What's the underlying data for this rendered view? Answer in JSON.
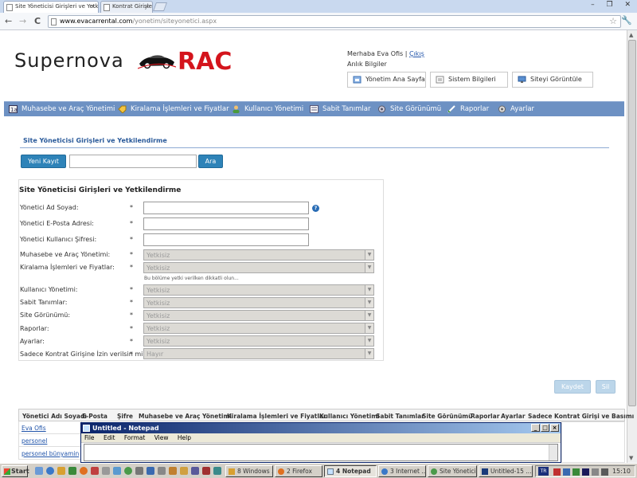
{
  "browser": {
    "tabs": [
      {
        "title": "Site Yöneticisi Girişleri ve Yetk",
        "close": "×"
      },
      {
        "title": "Kontrat Girişleri",
        "close": "×"
      }
    ],
    "window_controls": "– ❐ ✕",
    "url_host": "www.evacarrental.com",
    "url_path": "/yonetim/siteyonetici.aspx",
    "nav": {
      "back": "←",
      "forward": "→",
      "reload": "C"
    },
    "star": "☆",
    "wrench": "🔧"
  },
  "header": {
    "logo_text": "Supernova",
    "logo_rac": "RAC",
    "greeting": "Merhaba Eva Ofis |",
    "logout": "Çıkış",
    "anlik": "Anlık Bilgiler",
    "quick_links": [
      {
        "label": "Yönetim Ana Sayfa",
        "icon": "home-icon"
      },
      {
        "label": "Sistem Bilgileri",
        "icon": "info-icon"
      },
      {
        "label": "Siteyi Görüntüle",
        "icon": "monitor-icon"
      }
    ]
  },
  "menu": [
    {
      "label": "Muhasebe ve Araç Yönetimi",
      "icon": "ledger-icon"
    },
    {
      "label": "Kiralama İşlemleri ve Fiyatlar",
      "icon": "tag-icon"
    },
    {
      "label": "Kullanıcı Yönetimi",
      "icon": "user-icon"
    },
    {
      "label": "Sabit Tanımlar",
      "icon": "list-icon"
    },
    {
      "label": "Site Görünümü",
      "icon": "gear-icon"
    },
    {
      "label": "Raporlar",
      "icon": "report-icon"
    },
    {
      "label": "Ayarlar",
      "icon": "settings-icon"
    }
  ],
  "section_title": "Site Yöneticisi Girişleri ve Yetkilendirme",
  "search": {
    "new_button": "Yeni Kayıt",
    "search_button": "Ara",
    "value": ""
  },
  "form": {
    "title": "Site Yöneticisi Girişleri ve Yetkilendirme",
    "required_mark": "*",
    "fields": [
      {
        "label": "Yönetici Ad Soyad:",
        "type": "text",
        "value": ""
      },
      {
        "label": "Yönetici E-Posta Adresi:",
        "type": "text",
        "value": ""
      },
      {
        "label": "Yönetici Kullanıcı Şifresi:",
        "type": "text",
        "value": ""
      },
      {
        "label": "Muhasebe ve Araç Yönetimi:",
        "type": "select",
        "value": "Yetkisiz"
      },
      {
        "label": "Kiralama İşlemleri ve Fiyatlar:",
        "type": "select",
        "value": "Yetkisiz"
      },
      {
        "label": "Kullanıcı Yönetimi:",
        "type": "select",
        "value": "Yetkisiz"
      },
      {
        "label": "Sabit Tanımlar:",
        "type": "select",
        "value": "Yetkisiz"
      },
      {
        "label": "Site Görünümü:",
        "type": "select",
        "value": "Yetkisiz"
      },
      {
        "label": "Raporlar:",
        "type": "select",
        "value": "Yetkisiz"
      },
      {
        "label": "Ayarlar:",
        "type": "select",
        "value": "Yetkisiz"
      },
      {
        "label": "Sadece Kontrat Girişine İzin verilsin mi:",
        "type": "select",
        "value": "Hayır"
      }
    ],
    "help": "?",
    "note": "Bu bölüme yetki verilken dikkatli olun...",
    "save_button": "Kaydet",
    "delete_button": "Sil"
  },
  "table": {
    "headers": [
      "Yönetici Adı Soyadı",
      "E-Posta",
      "Şifre",
      "Muhasebe ve Araç Yönetimi",
      "Kiralama İşlemleri ve Fiyatlar",
      "Kullanıcı Yönetimi",
      "Sabit Tanımlar",
      "Site Görünümü",
      "Raporlar",
      "Ayarlar",
      "Sadece Kontrat Girişi ve Basımı"
    ],
    "rows": [
      "Eva Ofis",
      "personel",
      "personel bünyamin"
    ]
  },
  "notepad": {
    "title": "Untitled - Notepad",
    "menu": [
      "File",
      "Edit",
      "Format",
      "View",
      "Help"
    ],
    "buttons": [
      "_",
      "□",
      "×"
    ]
  },
  "taskbar": {
    "start": "Start",
    "tasks": [
      {
        "label": "8 Windows ...",
        "pressed": false
      },
      {
        "label": "2 Firefox",
        "pressed": false
      },
      {
        "label": "4 Notepad",
        "pressed": true
      },
      {
        "label": "3 Internet ...",
        "pressed": false
      },
      {
        "label": "Site Yönetici...",
        "pressed": false
      },
      {
        "label": "Untitled-15 ...",
        "pressed": false
      }
    ],
    "lang": "TR",
    "clock": "15:10"
  }
}
